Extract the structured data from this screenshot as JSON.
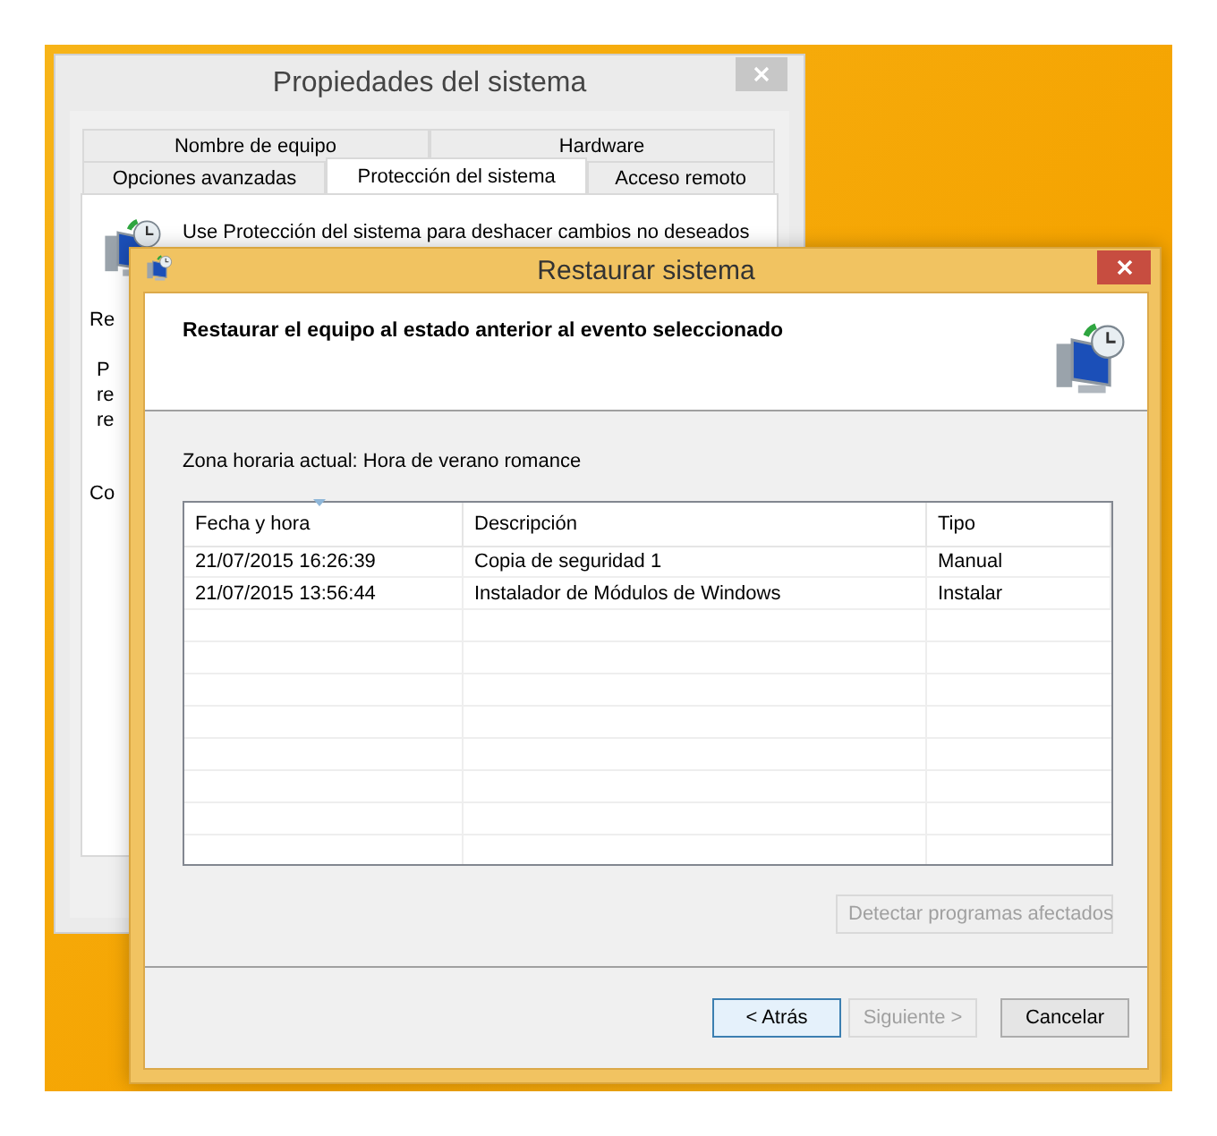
{
  "background_window": {
    "title": "Propiedades del sistema",
    "tab_rows": [
      [
        {
          "label": "Nombre de equipo",
          "selected": false
        },
        {
          "label": "Hardware",
          "selected": false
        }
      ],
      [
        {
          "label": "Opciones avanzadas",
          "selected": false
        },
        {
          "label": "Protección del sistema",
          "selected": true
        },
        {
          "label": "Acceso remoto",
          "selected": false
        }
      ]
    ],
    "description": "Use Protección del sistema para deshacer cambios no deseados",
    "partial_texts": [
      "Re",
      "P",
      "re",
      "re",
      "Co"
    ]
  },
  "restore_window": {
    "title": "Restaurar sistema",
    "heading": "Restaurar el equipo al estado anterior al evento seleccionado",
    "timezone": "Zona horaria actual: Hora de verano romance",
    "table": {
      "columns": [
        "Fecha y hora",
        "Descripción",
        "Tipo"
      ],
      "rows": [
        [
          "21/07/2015 16:26:39",
          "Copia de seguridad 1",
          "Manual"
        ],
        [
          "21/07/2015 13:56:44",
          "Instalador de Módulos de Windows",
          "Instalar"
        ]
      ]
    },
    "detect_button": {
      "label": "Detectar programas afectados",
      "disabled": true
    },
    "buttons": [
      {
        "label": "< Atrás",
        "disabled": false,
        "focused": true
      },
      {
        "label": "Siguiente >",
        "disabled": true,
        "focused": false
      },
      {
        "label": "Cancelar",
        "disabled": false,
        "focused": false
      }
    ]
  }
}
